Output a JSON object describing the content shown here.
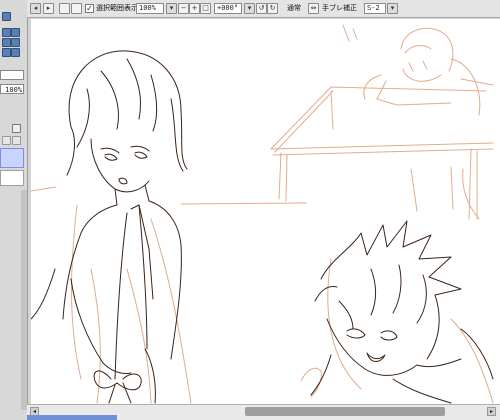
{
  "toolbar": {
    "checkbox_label": "選択範囲表示",
    "checkbox_checked": true,
    "zoom_value": "100%",
    "rotation_value": "+000°",
    "blend_mode": "通常",
    "stabilizer_label": "手ブレ補正",
    "stabilizer_value": "S-2"
  },
  "left_panel": {
    "opacity_value": "100%"
  },
  "colors": {
    "sketch": "#e2ab8d",
    "lineart": "#3a2416",
    "layer_selected": "#c9d4ff",
    "accent": "#5a7fb0"
  }
}
